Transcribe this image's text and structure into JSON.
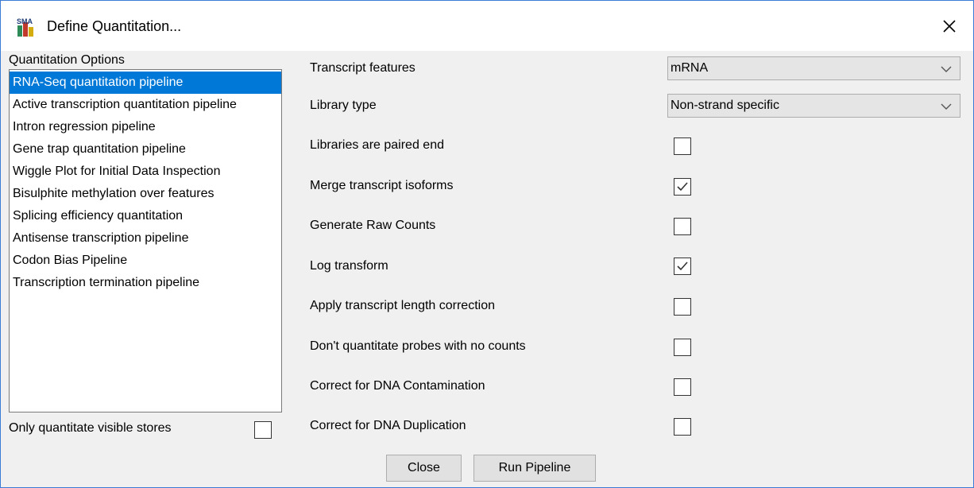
{
  "window": {
    "title": "Define Quantitation...",
    "app_icon_text": "SMA"
  },
  "options": {
    "label": "Quantitation Options",
    "items": [
      {
        "label": "RNA-Seq quantitation pipeline",
        "selected": true
      },
      {
        "label": "Active transcription quantitation pipeline",
        "selected": false
      },
      {
        "label": "Intron regression pipeline",
        "selected": false
      },
      {
        "label": "Gene trap quantitation pipeline",
        "selected": false
      },
      {
        "label": "Wiggle Plot for Initial Data Inspection",
        "selected": false
      },
      {
        "label": "Bisulphite methylation over features",
        "selected": false
      },
      {
        "label": "Splicing efficiency quantitation",
        "selected": false
      },
      {
        "label": "Antisense transcription pipeline",
        "selected": false
      },
      {
        "label": "Codon Bias Pipeline",
        "selected": false
      },
      {
        "label": "Transcription termination pipeline",
        "selected": false
      }
    ],
    "visible_stores_label": "Only quantitate visible stores",
    "visible_stores_checked": false
  },
  "settings": {
    "transcript_features": {
      "label": "Transcript features",
      "value": "mRNA"
    },
    "library_type": {
      "label": "Library type",
      "value": "Non-strand specific"
    },
    "checkboxes": [
      {
        "label": "Libraries are paired end",
        "checked": false
      },
      {
        "label": "Merge transcript isoforms",
        "checked": true
      },
      {
        "label": "Generate Raw Counts",
        "checked": false
      },
      {
        "label": "Log transform",
        "checked": true
      },
      {
        "label": "Apply transcript length correction",
        "checked": false
      },
      {
        "label": "Don't quantitate probes with no counts",
        "checked": false
      },
      {
        "label": "Correct for DNA Contamination",
        "checked": false
      },
      {
        "label": "Correct for DNA Duplication",
        "checked": false
      }
    ]
  },
  "buttons": {
    "close": "Close",
    "run": "Run Pipeline"
  },
  "colors": {
    "selection": "#0078d7",
    "window_border": "#3a7bd5",
    "dialog_background": "#f0f0f0"
  }
}
